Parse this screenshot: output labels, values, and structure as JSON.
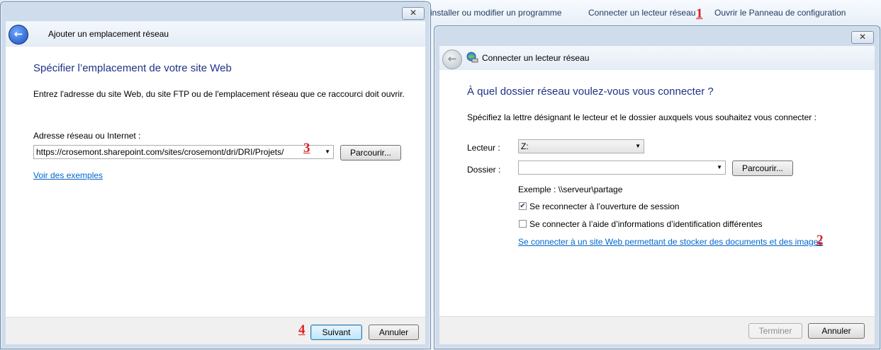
{
  "background": {
    "toolbar": {
      "item1": "installer ou modifier un programme",
      "item2": "Connecter un lecteur réseau",
      "item3": "Ouvrir le Panneau de configuration"
    }
  },
  "markers": {
    "m1": "1",
    "m2": "2",
    "m3": "3",
    "m4": "4"
  },
  "left_window": {
    "close_label": "✕",
    "title": "Ajouter un emplacement réseau",
    "heading": "Spécifier l’emplacement de votre site Web",
    "description": "Entrez l'adresse du site Web, du site FTP ou de l'emplacement réseau que ce raccourci doit ouvrir.",
    "address_label": "Adresse réseau ou Internet :",
    "address_value": "https://crosemont.sharepoint.com/sites/crosemont/dri/DRI/Projets/",
    "browse_label": "Parcourir...",
    "examples_link": "Voir des exemples",
    "next_label": "Suivant",
    "cancel_label": "Annuler"
  },
  "right_window": {
    "close_label": "✕",
    "title": "Connecter un lecteur réseau",
    "heading": "À quel dossier réseau voulez-vous vous connecter ?",
    "description": "Spécifiez la lettre désignant le lecteur et le dossier auxquels vous souhaitez vous connecter :",
    "drive_label": "Lecteur :",
    "drive_value": "Z:",
    "folder_label": "Dossier :",
    "folder_value": "",
    "browse_label": "Parcourir...",
    "example_text": "Exemple : \\\\serveur\\partage",
    "reconnect_label": "Se reconnecter à l’ouverture de session",
    "reconnect_checked": true,
    "other_creds_label": "Se connecter à l’aide d’informations d’identification différentes",
    "other_creds_checked": false,
    "website_link": "Se connecter à un site Web permettant de stocker des documents et des images",
    "finish_label": "Terminer",
    "cancel_label": "Annuler"
  },
  "colors": {
    "heading": "#1e3287",
    "link": "#0066cc",
    "marker": "#e02020"
  }
}
